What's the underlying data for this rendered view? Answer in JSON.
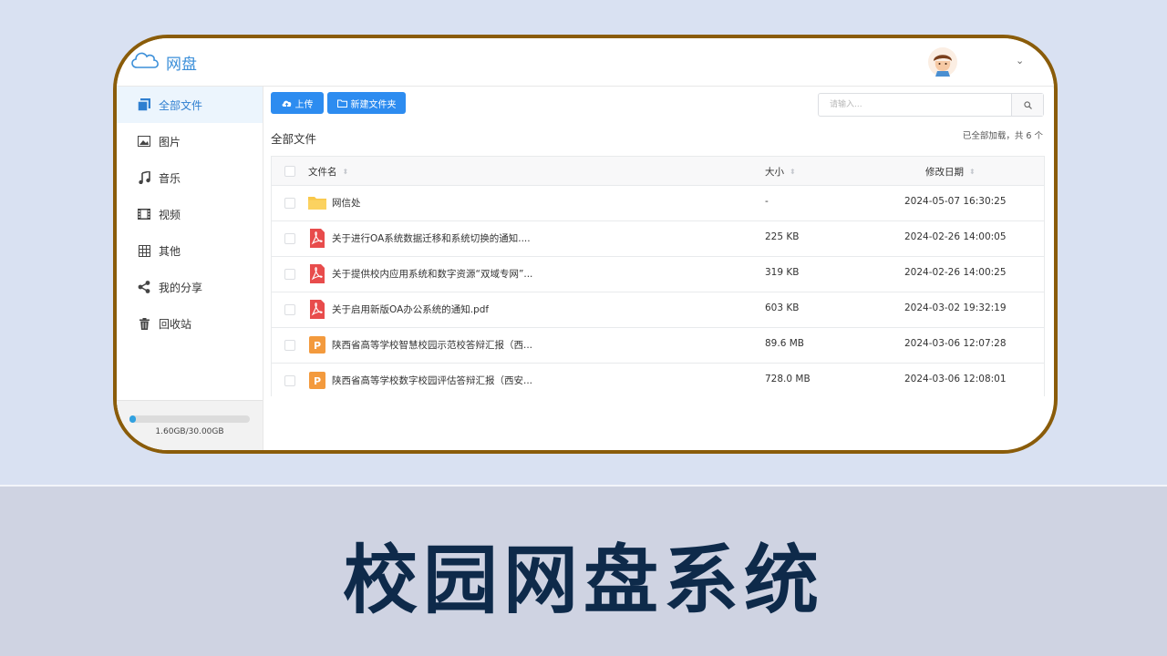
{
  "banner": {
    "title": "校园网盘系统"
  },
  "header": {
    "app_name": "网盘",
    "user_menu_caret": "⌄"
  },
  "sidebar": {
    "items": [
      {
        "label": "全部文件",
        "icon": "files-icon",
        "active": true
      },
      {
        "label": "图片",
        "icon": "image-icon",
        "active": false
      },
      {
        "label": "音乐",
        "icon": "music-icon",
        "active": false
      },
      {
        "label": "视频",
        "icon": "video-icon",
        "active": false
      },
      {
        "label": "其他",
        "icon": "grid-icon",
        "active": false
      },
      {
        "label": "我的分享",
        "icon": "share-icon",
        "active": false
      },
      {
        "label": "回收站",
        "icon": "trash-icon",
        "active": false
      }
    ],
    "storage": {
      "text": "1.60GB/30.00GB",
      "used_fraction": 0.053
    }
  },
  "toolbar": {
    "upload_label": "上传",
    "new_folder_label": "新建文件夹",
    "search_placeholder": "请输入..."
  },
  "main": {
    "breadcrumb": "全部文件",
    "loaded_status": "已全部加载，共 6 个"
  },
  "table": {
    "columns": {
      "name": "文件名",
      "size": "大小",
      "date": "修改日期"
    },
    "sort_glyph": "⬍",
    "rows": [
      {
        "type": "folder",
        "name": "网信处",
        "size": "-",
        "date": "2024-05-07 16:30:25"
      },
      {
        "type": "pdf",
        "name": "关于进行OA系统数据迁移和系统切换的通知....",
        "size": "225 KB",
        "date": "2024-02-26 14:00:05"
      },
      {
        "type": "pdf",
        "name": "关于提供校内应用系统和数字资源“双域专网”...",
        "size": "319 KB",
        "date": "2024-02-26 14:00:25"
      },
      {
        "type": "pdf",
        "name": "关于启用新版OA办公系统的通知.pdf",
        "size": "603 KB",
        "date": "2024-03-02 19:32:19"
      },
      {
        "type": "ppt",
        "name": "陕西省高等学校智慧校园示范校答辩汇报（西...",
        "size": "89.6 MB",
        "date": "2024-03-06 12:07:28"
      },
      {
        "type": "ppt",
        "name": "陕西省高等学校数字校园评估答辩汇报（西安...",
        "size": "728.0 MB",
        "date": "2024-03-06 12:08:01"
      }
    ]
  },
  "colors": {
    "accent": "#2d8cf0",
    "frame": "#8a5c0a",
    "banner_text": "#0e2a4a",
    "folder": "#f9c84a",
    "pdf": "#e84c4c",
    "ppt": "#f39a3d"
  }
}
